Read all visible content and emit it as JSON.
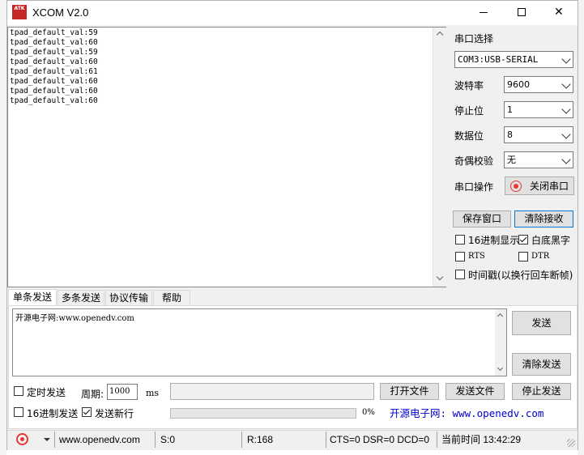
{
  "window": {
    "title": "XCOM V2.0",
    "logo_text": "ATK",
    "controls": {
      "minimize": "—",
      "maximize": "☐",
      "close": "✕"
    }
  },
  "receive": {
    "lines": [
      "tpad_default_val:59",
      "tpad_default_val:60",
      "tpad_default_val:59",
      "tpad_default_val:60",
      "tpad_default_val:61",
      "tpad_default_val:60",
      "tpad_default_val:60",
      "tpad_default_val:60"
    ]
  },
  "settings": {
    "port_label": "串口选择",
    "port_value": "COM3:USB-SERIAL",
    "baud_label": "波特率",
    "baud_value": "9600",
    "stopbits_label": "停止位",
    "stopbits_value": "1",
    "databits_label": "数据位",
    "databits_value": "8",
    "parity_label": "奇偶校验",
    "parity_value": "无",
    "op_label": "串口操作",
    "op_button": "关闭串口",
    "save_window": "保存窗口",
    "clear_receive": "清除接收",
    "hex_display": "16进制显示",
    "white_black": "白底黑字",
    "rts": "RTS",
    "dtr": "DTR",
    "timestamp": "时间戳(以换行回车断帧)"
  },
  "tabs": [
    "单条发送",
    "多条发送",
    "协议传输",
    "帮助"
  ],
  "send": {
    "text": "开源电子网:www.openedv.com",
    "send_button": "发送",
    "clear_send_button": "清除发送",
    "timed_send": "定时发送",
    "period_label": "周期:",
    "period_value": "1000",
    "period_unit": "ms",
    "hex_send": "16进制发送",
    "send_newline": "发送新行",
    "open_file": "打开文件",
    "send_file": "发送文件",
    "stop_send": "停止发送",
    "progress_percent": "0%",
    "banner": "开源电子网: www.openedv.com"
  },
  "status": {
    "website": "www.openedv.com",
    "sent": "S:0",
    "received": "R:168",
    "signals": "CTS=0 DSR=0 DCD=0",
    "time": "当前时间 13:42:29"
  },
  "colors": {
    "banner_text": "#0000cc",
    "record_icon": "#e53935"
  }
}
